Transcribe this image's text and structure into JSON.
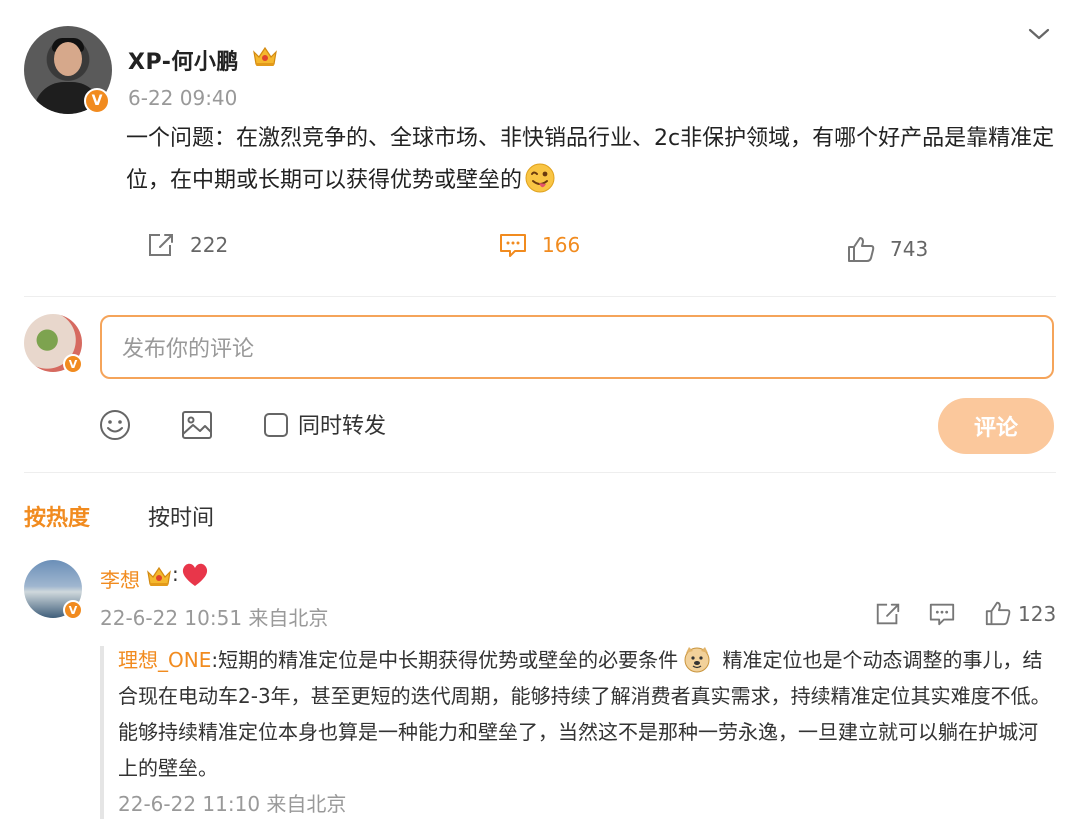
{
  "post": {
    "username": "XP-何小鹏",
    "time": "6-22 09:40",
    "text": "一个问题：在激烈竞争的、全球市场、非快销品行业、2c非保护领域，有哪个好产品是靠精准定位，在中期或长期可以获得优势或壁垒的",
    "verified_mark": "V"
  },
  "actions": {
    "repost_count": "222",
    "comment_count": "166",
    "like_count": "743"
  },
  "composer": {
    "placeholder": "发布你的评论",
    "also_repost_label": "同时转发",
    "submit_label": "评论",
    "verified_mark": "V"
  },
  "sort_tabs": {
    "hot": "按热度",
    "time": "按时间"
  },
  "comment": {
    "username": "李想",
    "colon": ":",
    "meta": "22-6-22 10:51 来自北京",
    "like_count": "123",
    "verified_mark": "V",
    "reply": {
      "username": "理想_ONE",
      "text_part1": ":短期的精准定位是中长期获得优势或壁垒的必要条件",
      "text_part2": " 精准定位也是个动态调整的事儿，结合现在电动车2-3年，甚至更短的迭代周期，能够持续了解消费者真实需求，持续精准定位其实难度不低。能够持续精准定位本身也算是一种能力和壁垒了，当然这不是那种一劳永逸，一旦建立就可以躺在护城河上的壁垒。",
      "meta": "22-6-22 11:10 来自北京"
    }
  },
  "colors": {
    "accent": "#f18b1f",
    "submit_disabled": "#fbc89c",
    "input_border": "#f5a45a",
    "muted_text": "#999999"
  }
}
